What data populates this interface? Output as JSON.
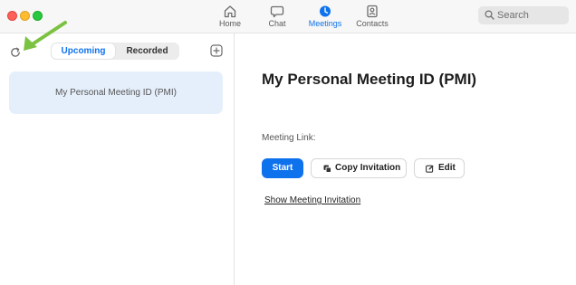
{
  "window": {
    "traffic_lights": [
      "close",
      "minimize",
      "maximize"
    ]
  },
  "nav": {
    "tabs": [
      {
        "label": "Home",
        "icon": "home-icon",
        "active": false
      },
      {
        "label": "Chat",
        "icon": "chat-icon",
        "active": false
      },
      {
        "label": "Meetings",
        "icon": "clock-icon",
        "active": true
      },
      {
        "label": "Contacts",
        "icon": "contacts-icon",
        "active": false
      }
    ]
  },
  "search": {
    "placeholder": "Search",
    "icon": "search-icon"
  },
  "sidebar": {
    "refresh_icon": "refresh-icon",
    "segment": {
      "upcoming_label": "Upcoming",
      "recorded_label": "Recorded",
      "selected": "Upcoming"
    },
    "add_icon": "plus-square-icon",
    "meetings": [
      {
        "title": "My Personal Meeting ID (PMI)",
        "selected": true
      }
    ]
  },
  "annotation": {
    "type": "arrow",
    "points_to": "refresh-icon"
  },
  "detail": {
    "title": "My Personal Meeting ID (PMI)",
    "meeting_link_label": "Meeting Link:",
    "start_label": "Start",
    "copy_invitation_label": "Copy Invitation",
    "edit_label": "Edit",
    "show_invitation_label": "Show Meeting Invitation"
  },
  "colors": {
    "accent": "#0e72ed",
    "selected_card_bg": "#e5effb",
    "annotation_arrow": "#7cc242",
    "close": "#fe5f57",
    "minimize": "#febc2e",
    "maximize": "#28c840"
  }
}
